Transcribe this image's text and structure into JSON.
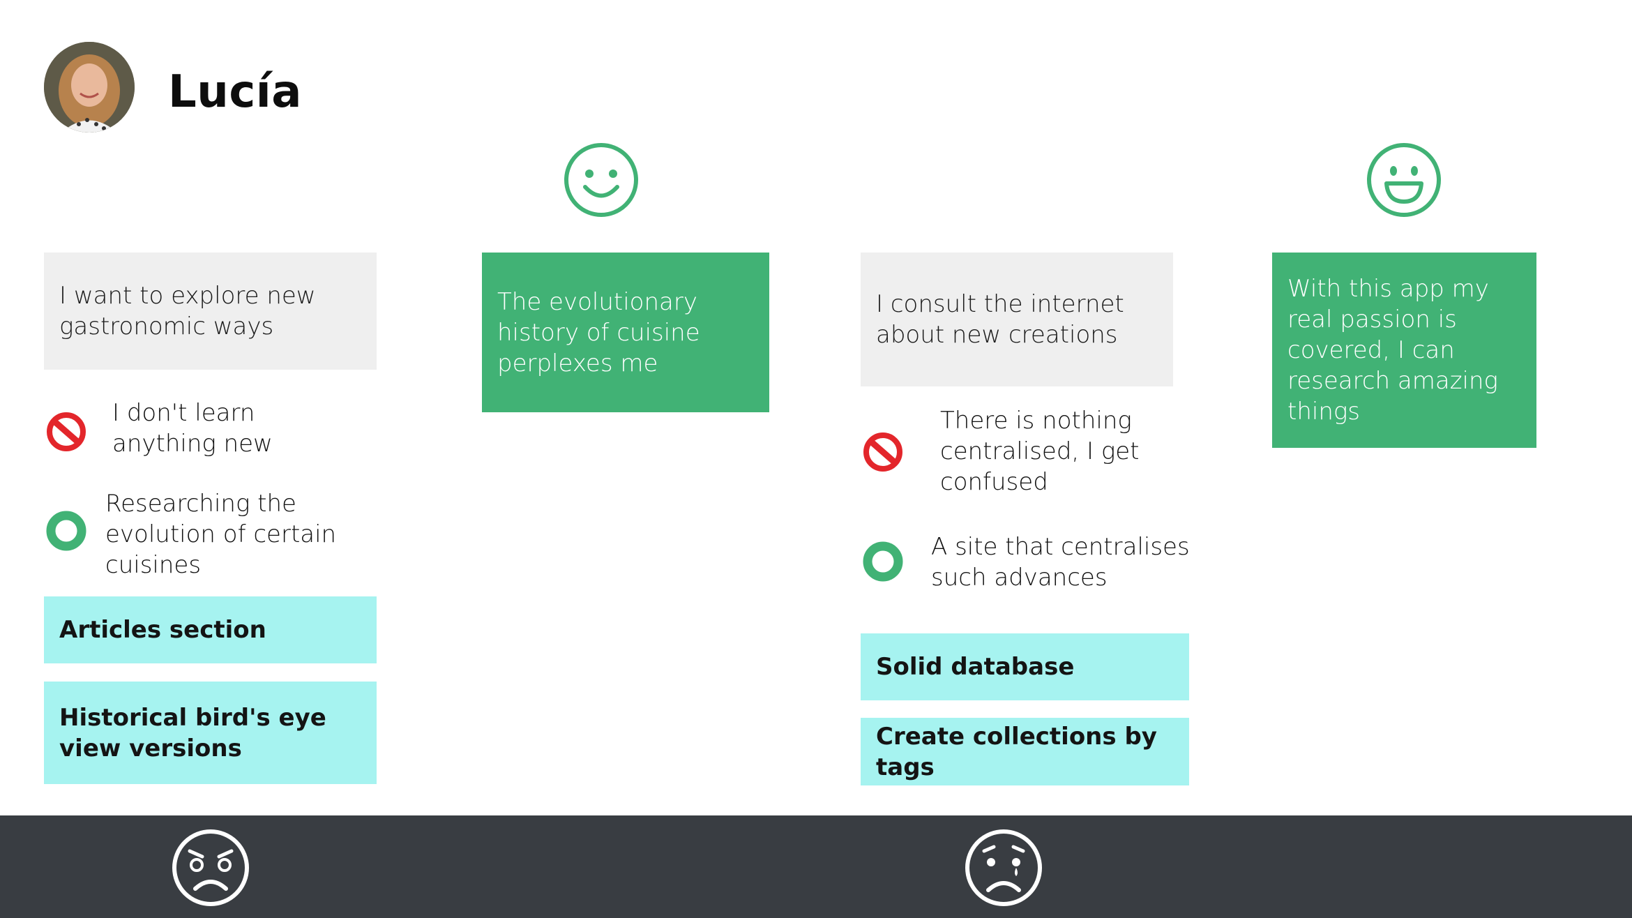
{
  "persona": {
    "name": "Lucía",
    "avatar_icon": "user-photo-avatar"
  },
  "colors": {
    "accent_green": "#41b275",
    "note_grey": "#efefef",
    "feature_cyan": "#a6f3f0",
    "footer_dark": "#393d42",
    "pain_red": "#e3262b"
  },
  "columns": [
    {
      "emotion_icon": null,
      "need": "I want to explore new gastronomic ways",
      "pain": "I don't learn anything new",
      "opportunity": "Researching the evolution of certain cuisines",
      "features": [
        "Articles section",
        "Historical bird's eye view versions"
      ],
      "footer_emotion_icon": "angry-face-icon"
    },
    {
      "emotion_icon": "smiling-face-icon",
      "thought": "The evolutionary history of cuisine perplexes me"
    },
    {
      "emotion_icon": null,
      "need": "I consult the internet about new creations",
      "pain": "There is nothing centralised, I get confused",
      "opportunity": "A site that centralises such advances",
      "features": [
        "Solid database",
        "Create collections by tags"
      ],
      "footer_emotion_icon": "crying-face-icon"
    },
    {
      "emotion_icon": "grinning-face-icon",
      "thought": "With this app my real passion is covered, I can research amazing things"
    }
  ]
}
